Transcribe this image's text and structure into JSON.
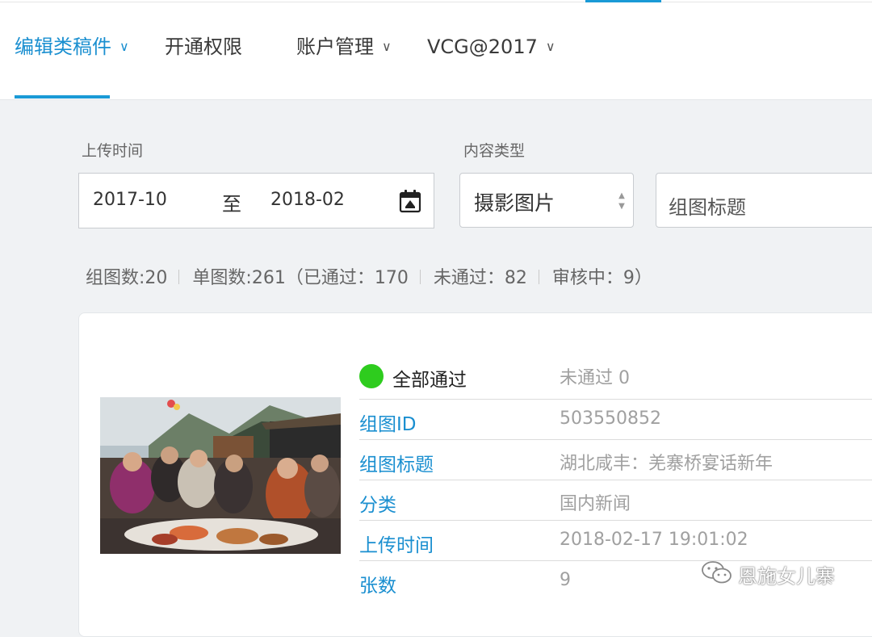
{
  "nav": {
    "items": [
      {
        "label": "编辑类稿件",
        "has_dropdown": true,
        "active": true
      },
      {
        "label": "开通权限",
        "has_dropdown": false,
        "active": false
      },
      {
        "label": "账户管理",
        "has_dropdown": true,
        "active": false
      },
      {
        "label": "VCG@2017",
        "has_dropdown": true,
        "active": false
      }
    ]
  },
  "filters": {
    "upload_time_label": "上传时间",
    "date_from": "2017-10",
    "date_sep": "至",
    "date_to": "2018-02",
    "content_type_label": "内容类型",
    "content_type_value": "摄影图片",
    "title_placeholder": "组图标题"
  },
  "stats": {
    "group_count": "组图数:20",
    "single_count": "单图数:261（已通过：170",
    "rejected": "未通过：82",
    "reviewing": "审核中：9）"
  },
  "record": {
    "status_label": "全部通过",
    "status_color": "#2ecc1e",
    "rejected_label": "未通过 0",
    "rows": [
      {
        "key": "组图ID",
        "value": "503550852"
      },
      {
        "key": "组图标题",
        "value": "湖北咸丰：羌寨桥宴话新年"
      },
      {
        "key": "分类",
        "value": "国内新闻"
      },
      {
        "key": "上传时间",
        "value": "2018-02-17 19:01:02"
      },
      {
        "key": "张数",
        "value": "9"
      }
    ]
  },
  "watermark": {
    "text": "恩施女儿寨"
  },
  "colors": {
    "accent": "#1a8fd0",
    "success": "#2ecc1e"
  }
}
